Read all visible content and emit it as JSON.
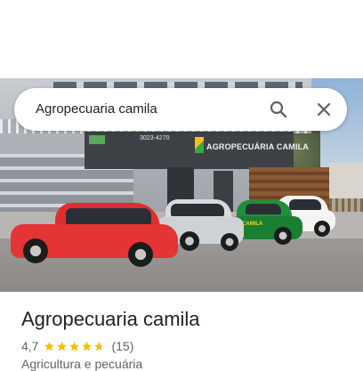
{
  "search": {
    "query": "Agropecuaria camila"
  },
  "photo": {
    "sign_text": "AGROPECUÁRIA CAMILA",
    "sign_phone": "3023-4270",
    "van_text": "CAMILA"
  },
  "place": {
    "title": "Agropecuaria camila",
    "rating": "4,7",
    "stars_value": 4.7,
    "reviews": "(15)",
    "category": "Agricultura e pecuária"
  },
  "colors": {
    "star": "#fbbc04",
    "star_empty": "#dadce0",
    "text_primary": "#202124",
    "text_secondary": "#5f6368"
  },
  "icons": {
    "search": "search-icon",
    "close": "close-icon"
  }
}
